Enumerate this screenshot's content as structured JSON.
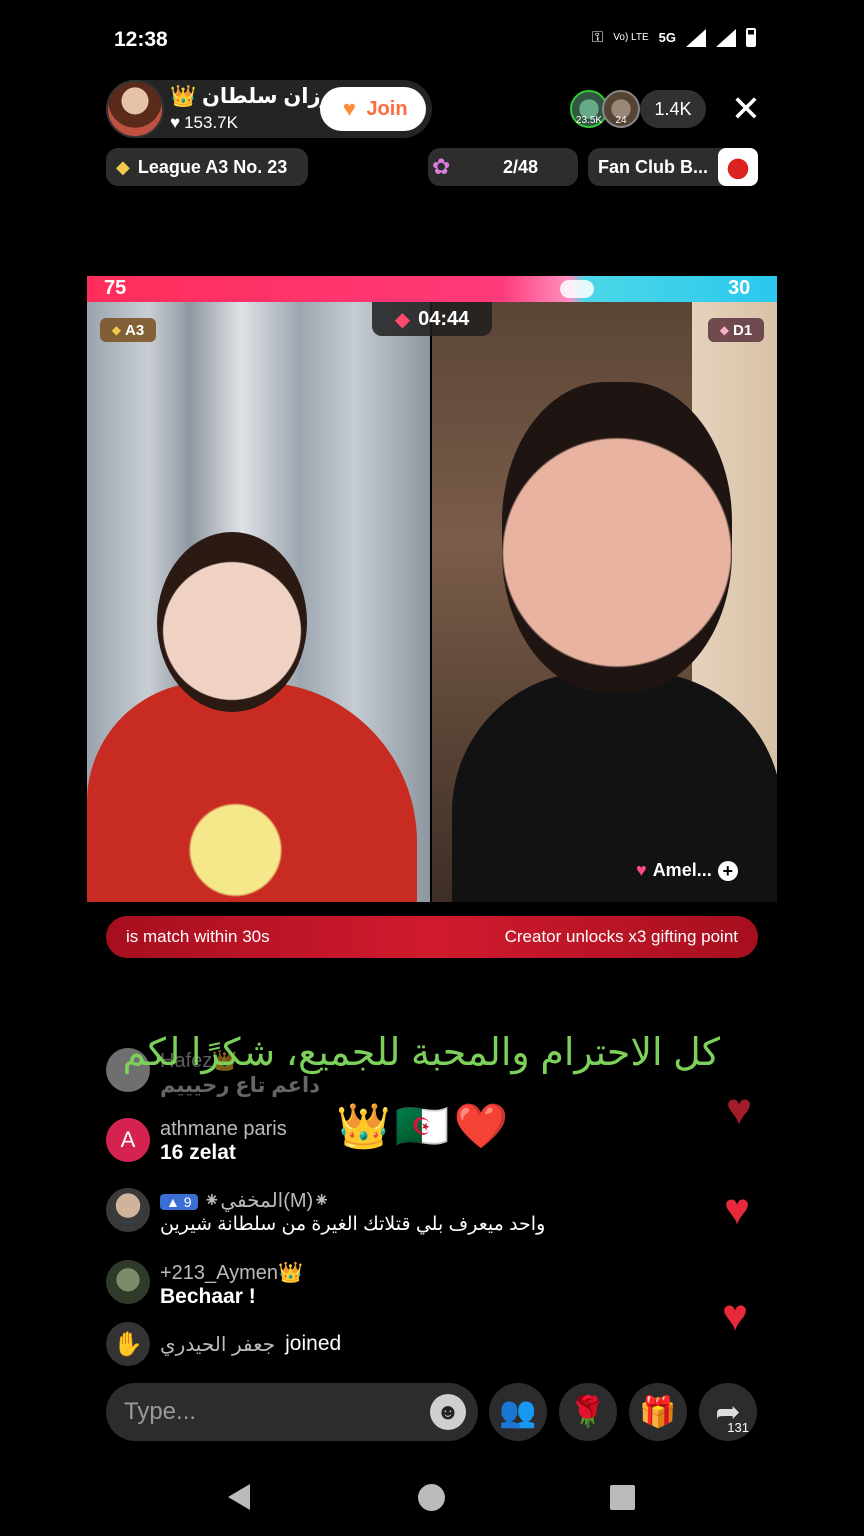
{
  "status_bar": {
    "time": "12:38",
    "network": "5G",
    "volte": "Vo) LTE"
  },
  "host": {
    "name": "رزان سلطان",
    "crown": "👑",
    "likes": "153.7K",
    "join_label": "Join"
  },
  "viewers": {
    "top1_badge": "23.5K",
    "top2_badge": "24",
    "count": "1.4K"
  },
  "league": {
    "label": "League A3 No. 23"
  },
  "rank": {
    "label": "2/48"
  },
  "fan_club": {
    "label": "Fan Club B..."
  },
  "battle": {
    "score_left": "75",
    "score_right": "30",
    "timer": "04:44",
    "tier_left": "A3",
    "tier_right": "D1",
    "opponent_name": "Amel..."
  },
  "banner": {
    "left_text": "is match within 30s",
    "right_text": "Creator unlocks x3 gifting point"
  },
  "caption": {
    "text": "كل الاحترام والمحبة للجميع، شكرًا لكم",
    "emojis": "👑🇩🇿❤️"
  },
  "comments": [
    {
      "user": "Hafez👑",
      "text": "داعم تاع رحيييم",
      "avatar": "blank"
    },
    {
      "user": "athmane paris",
      "text": "16 zelat",
      "avatar": "A"
    },
    {
      "user": "⁕المخفي(M)⁕",
      "level": "9",
      "text": "واحد ميعرف بلي قتلاتك الغيرة من سلطانة شيرين",
      "avatar": "photo"
    },
    {
      "user": "+213_Aymen👑",
      "text": "Bechaar !",
      "avatar": "photo"
    },
    {
      "user": "جعفر الحيدري",
      "text": "joined",
      "avatar": "hand"
    }
  ],
  "input": {
    "placeholder": "Type...",
    "share_count": "131"
  },
  "colors": {
    "join_text": "#ff6b3a",
    "battle_left": "#ff2d5a",
    "battle_right": "#2ac8ef",
    "banner": "#d11a2e",
    "caption": "#7dd05a",
    "heart": "#e8283b"
  }
}
